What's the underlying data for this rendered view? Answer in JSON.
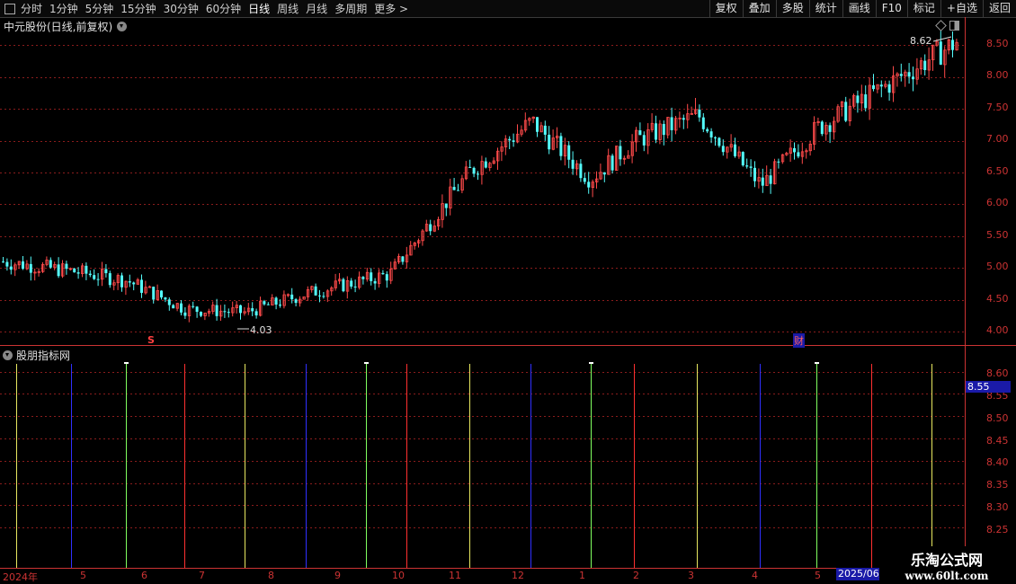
{
  "toolbar": {
    "periods": [
      "分时",
      "1分钟",
      "5分钟",
      "15分钟",
      "30分钟",
      "60分钟",
      "日线",
      "周线",
      "月线",
      "多周期",
      "更多 >"
    ],
    "active_period": "日线",
    "right_buttons": [
      "复权",
      "叠加",
      "多股",
      "统计",
      "画线",
      "F10",
      "标记",
      "+自选",
      "返回"
    ]
  },
  "chart_title": "中元股份(日线,前复权)",
  "indicator_title": "股朋指标网",
  "price_axis": [
    "8.50",
    "8.00",
    "7.50",
    "7.00",
    "6.50",
    "6.00",
    "5.50",
    "5.00",
    "4.50",
    "4.00"
  ],
  "indicator_axis": [
    "8.60",
    "8.55",
    "8.50",
    "8.45",
    "8.40",
    "8.35",
    "8.30",
    "8.25"
  ],
  "high_label": "8.62",
  "low_label": "4.03",
  "current_value": "8.55",
  "marker_s": "S",
  "marker_cai": "财",
  "date_axis": [
    "2024年",
    "5",
    "6",
    "7",
    "8",
    "9",
    "10",
    "11",
    "12",
    "1",
    "2",
    "3",
    "4",
    "5"
  ],
  "date_highlight": "2025/06/",
  "watermark": {
    "line1": "乐淘公式网",
    "line2": "www.60lt.com"
  },
  "colors": {
    "up": "#ff4a4a",
    "down": "#54fcfc",
    "grid": "#8a1c1c",
    "axis": "#cc3333"
  },
  "chart_data": {
    "type": "line",
    "x": [
      "2024-04",
      "2024-05",
      "2024-06",
      "2024-07",
      "2024-08",
      "2024-09",
      "2024-10",
      "2024-11",
      "2024-12",
      "2025-01",
      "2025-02",
      "2025-03",
      "2025-04",
      "2025-05",
      "2025-06"
    ],
    "series": [
      {
        "values": [
          5.1,
          4.95,
          4.8,
          4.35,
          4.3,
          4.6,
          4.9,
          6.5,
          7.3,
          6.4,
          7.0,
          7.4,
          6.3,
          7.2,
          8.55
        ]
      }
    ],
    "ylim": [
      3.9,
      8.7
    ],
    "grid": true
  }
}
